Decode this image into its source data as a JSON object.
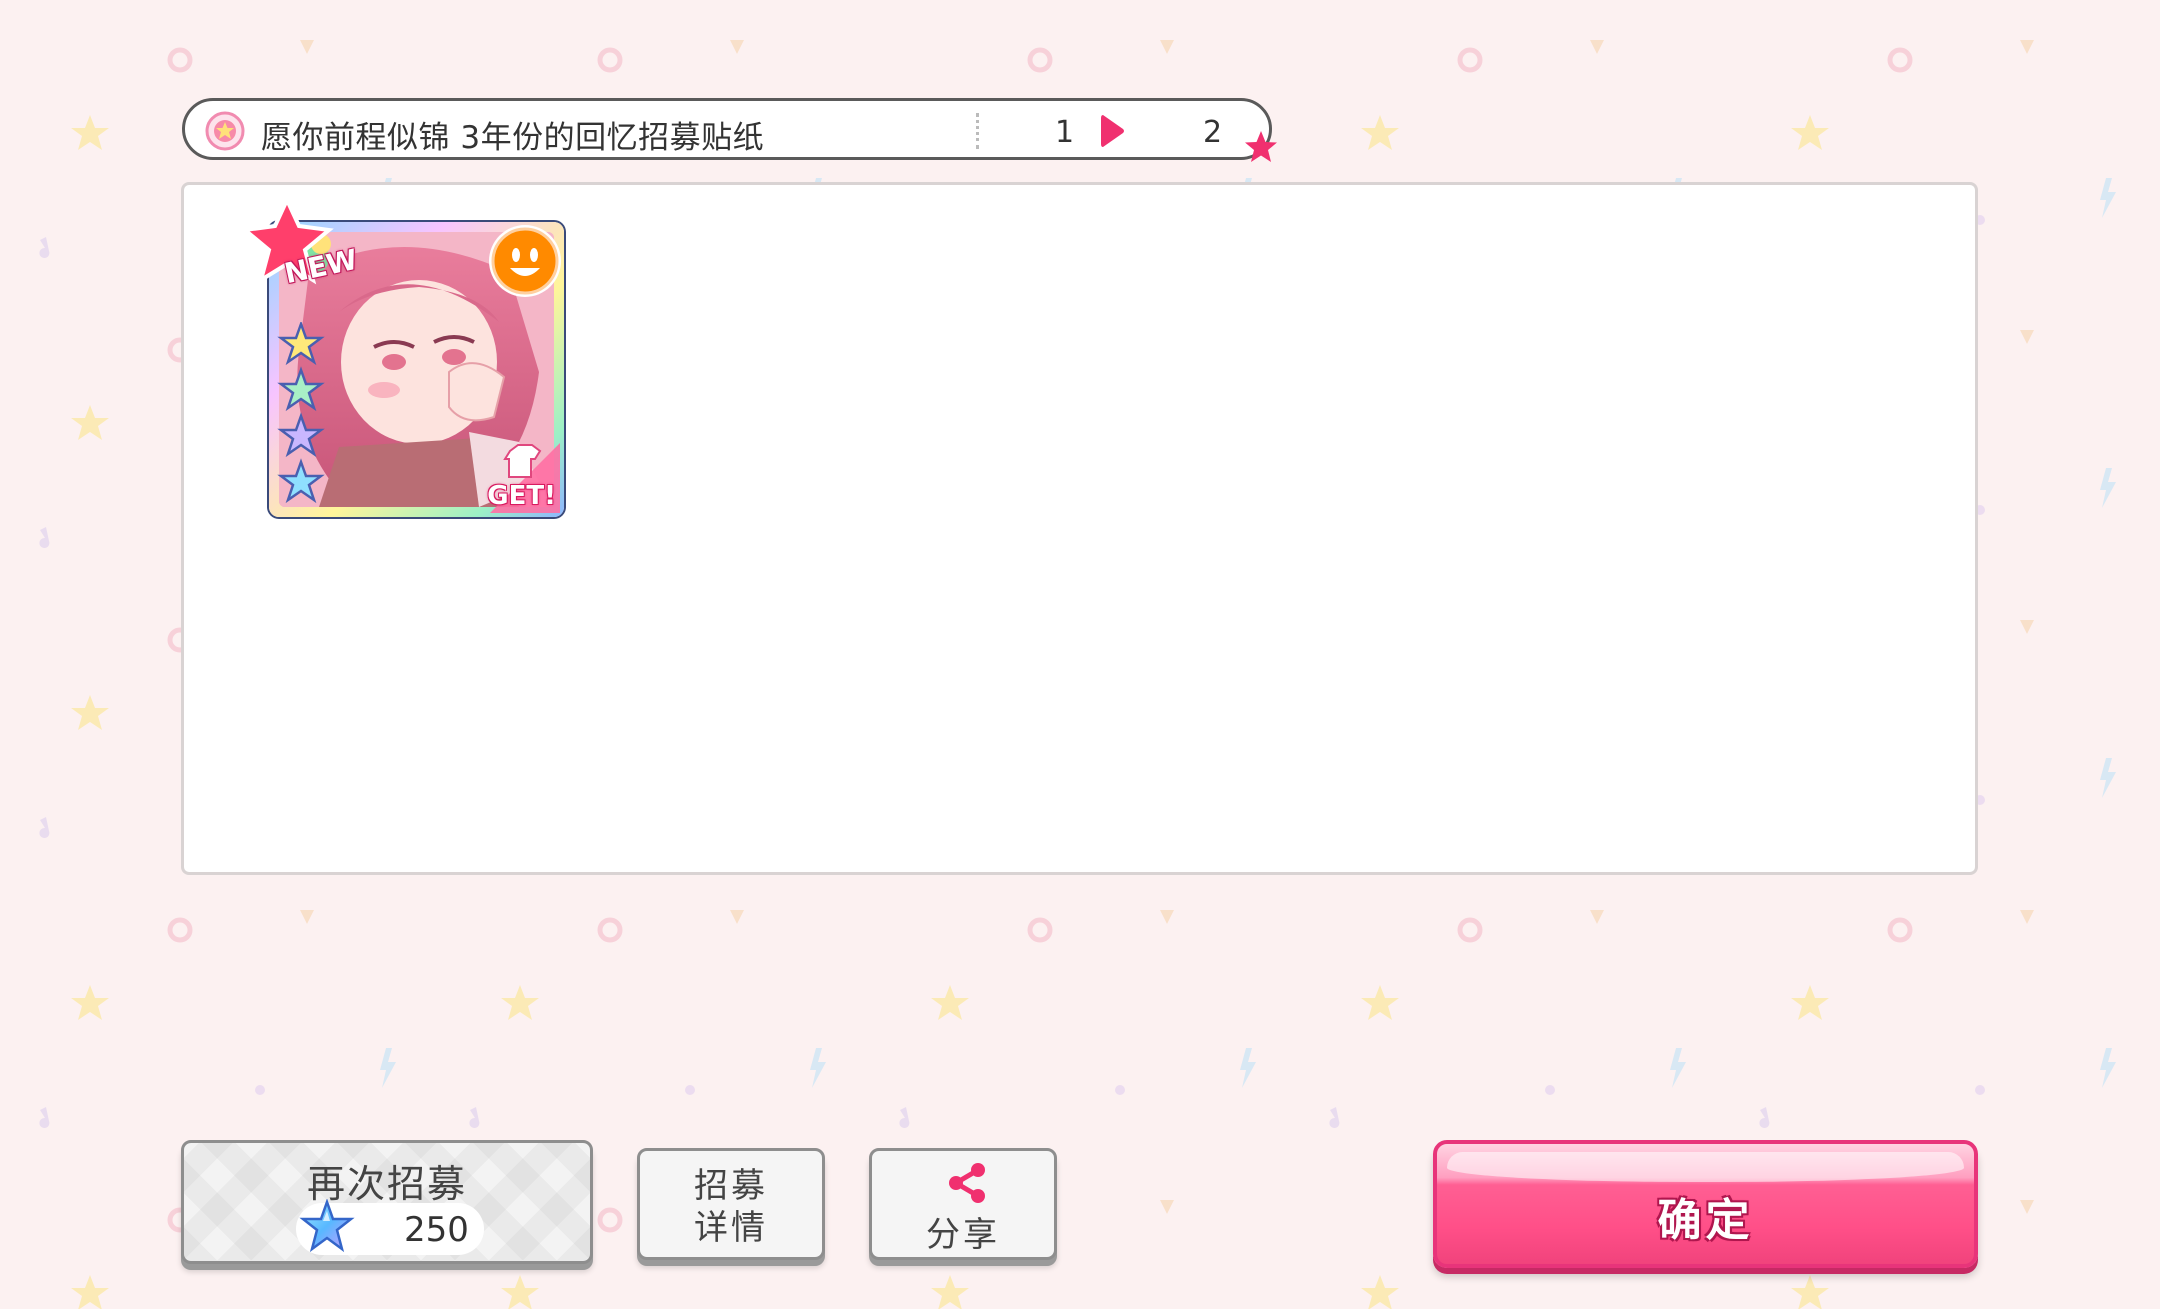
{
  "header": {
    "gacha_name": "愿你前程似锦 3年份的回忆招募贴纸",
    "page_current": "1",
    "page_total": "2",
    "icons": [
      "sticker-badge-icon",
      "next-page-arrow-icon",
      "star-icon"
    ]
  },
  "results": {
    "cards": [
      {
        "new_label": "NEW",
        "get_label": "GET!",
        "rarity": 4,
        "attribute": "happy",
        "icons": [
          "new-badge-icon",
          "happy-attribute-icon",
          "rarity-star-icon",
          "costume-get-icon"
        ]
      }
    ]
  },
  "footer": {
    "recruit_again_label": "再次招募",
    "recruit_cost": "250",
    "recruit_detail_label": "招募\n详情",
    "share_label": "分享",
    "confirm_label": "确定",
    "icons": [
      "star-gem-icon",
      "share-icon"
    ]
  },
  "colors": {
    "background": "#fcf1f1",
    "accent_pink": "#ff4f88",
    "button_border_gray": "#8e8e8e",
    "happy_orange": "#ff8a00"
  }
}
